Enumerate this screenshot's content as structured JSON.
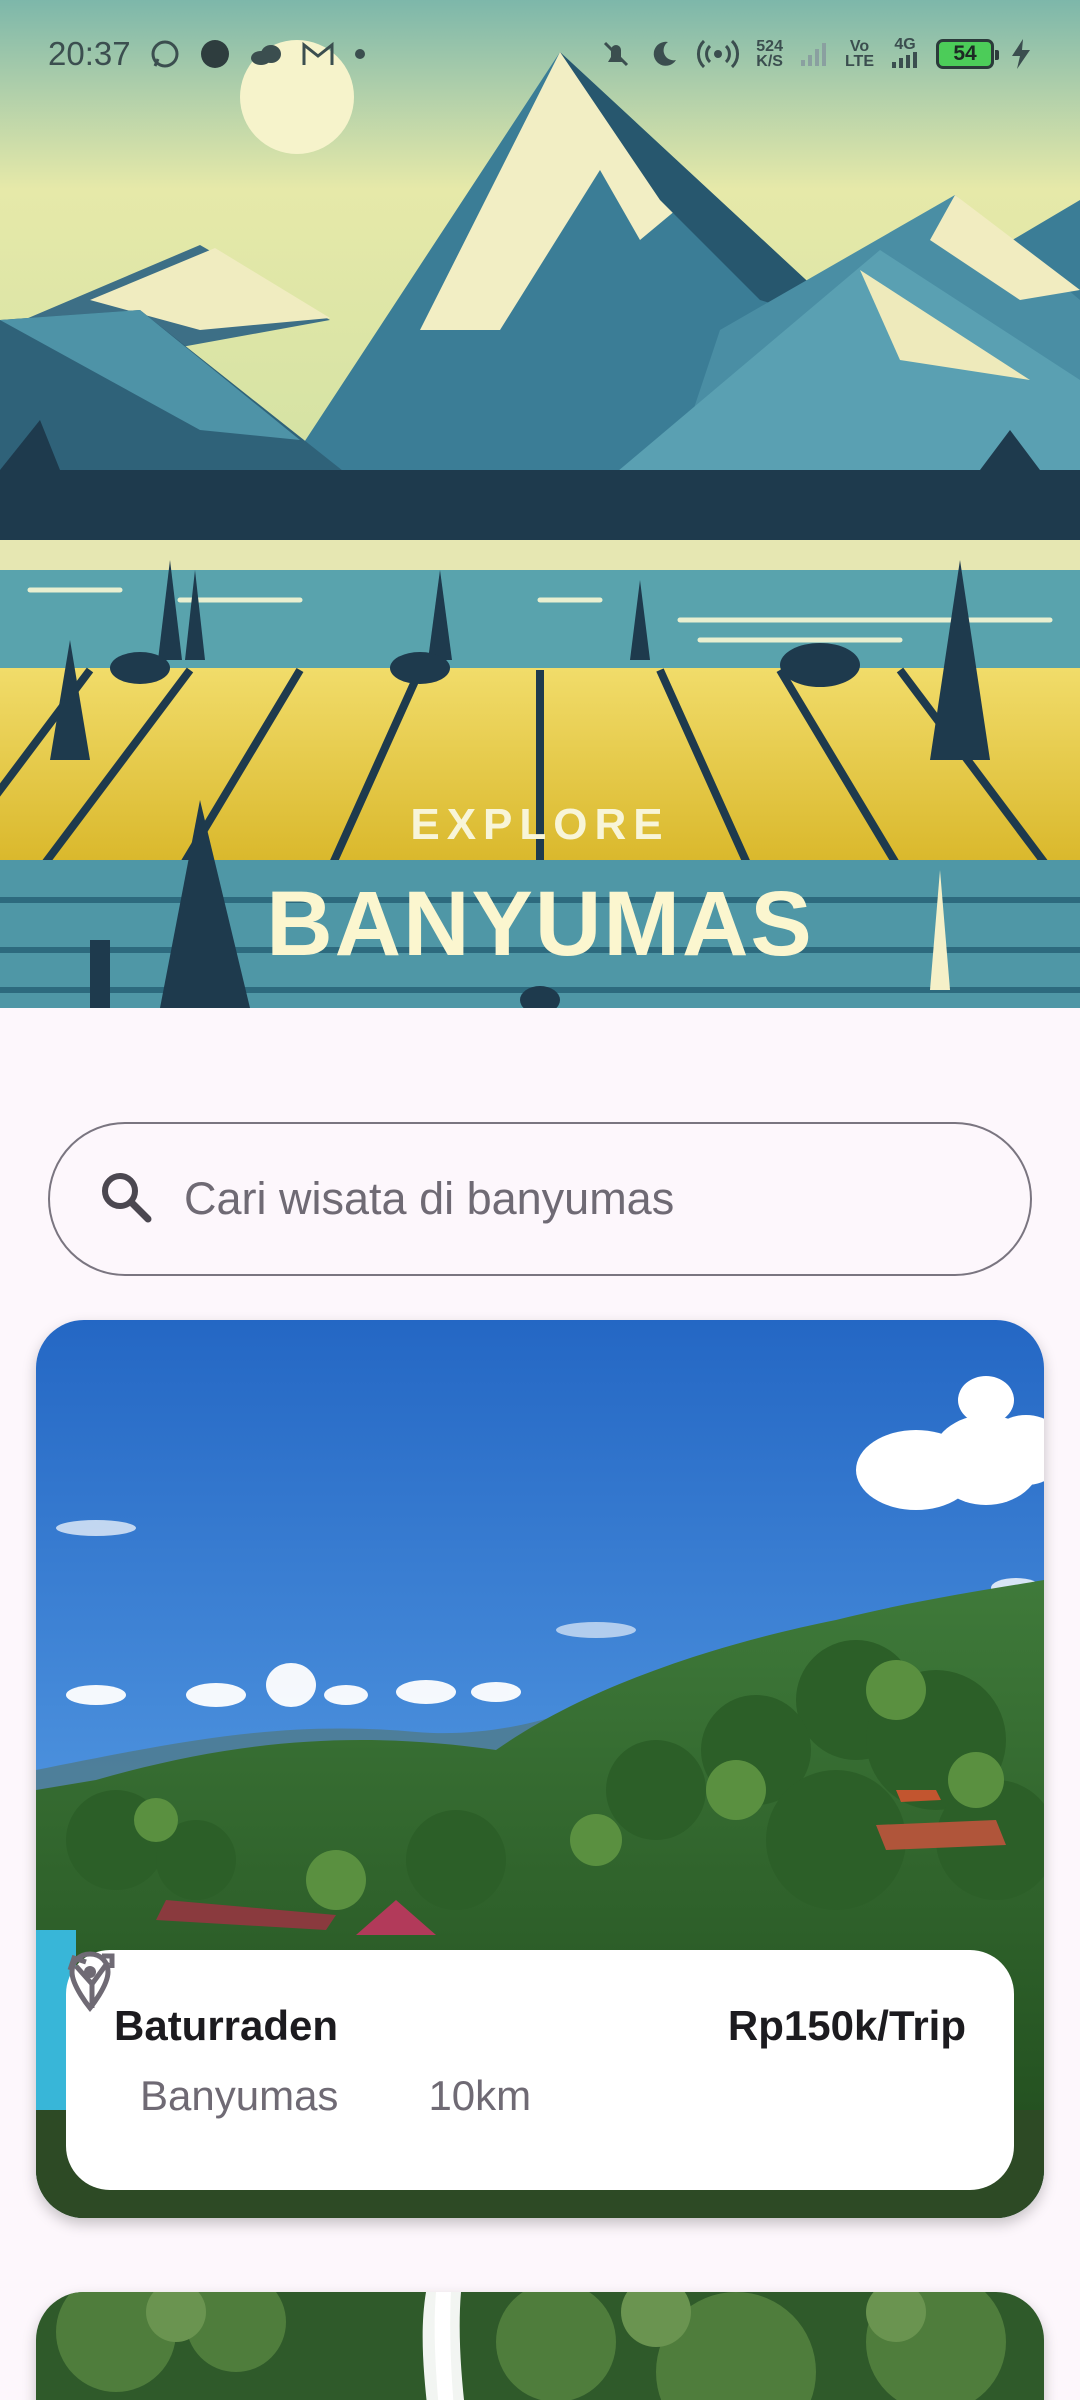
{
  "status_bar": {
    "time": "20:37",
    "left_icons": [
      "whatsapp-icon",
      "dot-icon",
      "cloud-icon",
      "gmail-icon",
      "small-dot-icon"
    ],
    "net_speed_value": "524",
    "net_speed_unit": "K/S",
    "volte_top": "Vo",
    "volte_bottom": "LTE",
    "network": "4G",
    "battery": "54",
    "colors": {
      "battery_fill": "#4ccc59"
    }
  },
  "hero": {
    "subtitle": "EXPLORE",
    "title": "BANYUMAS"
  },
  "search": {
    "placeholder": "Cari wisata di banyumas",
    "icon": "search-icon"
  },
  "cards": [
    {
      "name": "Baturraden",
      "price": "Rp150k/Trip",
      "location": "Banyumas",
      "distance": "10km",
      "location_icon": "location-pin-icon",
      "distance_icon": "fork-route-icon"
    },
    {
      "image": "waterfall-photo"
    }
  ],
  "colors": {
    "background": "#fdf7fc",
    "hero_cream": "#fbf6cf",
    "sky_blue": "#2f76d0",
    "text_dark": "#1c1b1f",
    "text_muted": "#6f6a74"
  }
}
